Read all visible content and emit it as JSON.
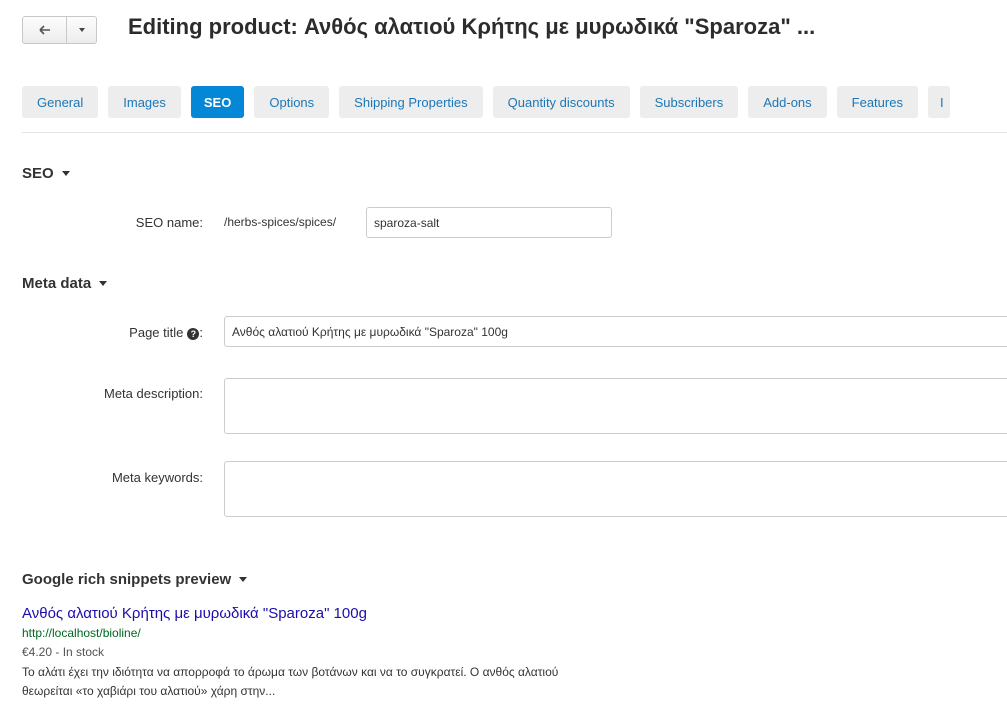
{
  "header": {
    "title": "Editing product: Ανθός αλατιού Κρήτης με μυρωδικά \"Sparoza\" ...",
    "back_icon": "arrow-left-icon",
    "menu_icon": "caret-down-icon"
  },
  "tabs": [
    {
      "label": "General"
    },
    {
      "label": "Images"
    },
    {
      "label": "SEO",
      "active": true
    },
    {
      "label": "Options"
    },
    {
      "label": "Shipping Properties"
    },
    {
      "label": "Quantity discounts"
    },
    {
      "label": "Subscribers"
    },
    {
      "label": "Add-ons"
    },
    {
      "label": "Features"
    },
    {
      "label": "I"
    }
  ],
  "seo": {
    "section_title": "SEO",
    "name_label": "SEO name:",
    "path_prefix": "/herbs-spices/spices/",
    "name_value": "sparoza-salt"
  },
  "meta": {
    "section_title": "Meta data",
    "page_title_label": "Page title",
    "page_title_suffix": ":",
    "page_title_value": "Ανθός αλατιού Κρήτης με μυρωδικά \"Sparoza\" 100g",
    "description_label": "Meta description:",
    "description_value": "",
    "keywords_label": "Meta keywords:",
    "keywords_value": ""
  },
  "snippets": {
    "section_title": "Google rich snippets preview",
    "title": "Ανθός αλατιού Κρήτης με μυρωδικά \"Sparoza\" 100g",
    "url": "http://localhost/bioline/",
    "price": "€4.20 - In stock",
    "description": "Το αλάτι έχει την ιδιότητα να απορροφά το άρωμα των βοτάνων και να το συγκρατεί. Ο ανθός αλατιού θεωρείται «το χαβιάρι του αλατιού» χάρη στην..."
  },
  "colors": {
    "accent": "#0387d6",
    "tab_text": "#1d77b7",
    "link": "#1a0dab",
    "url": "#006621"
  }
}
